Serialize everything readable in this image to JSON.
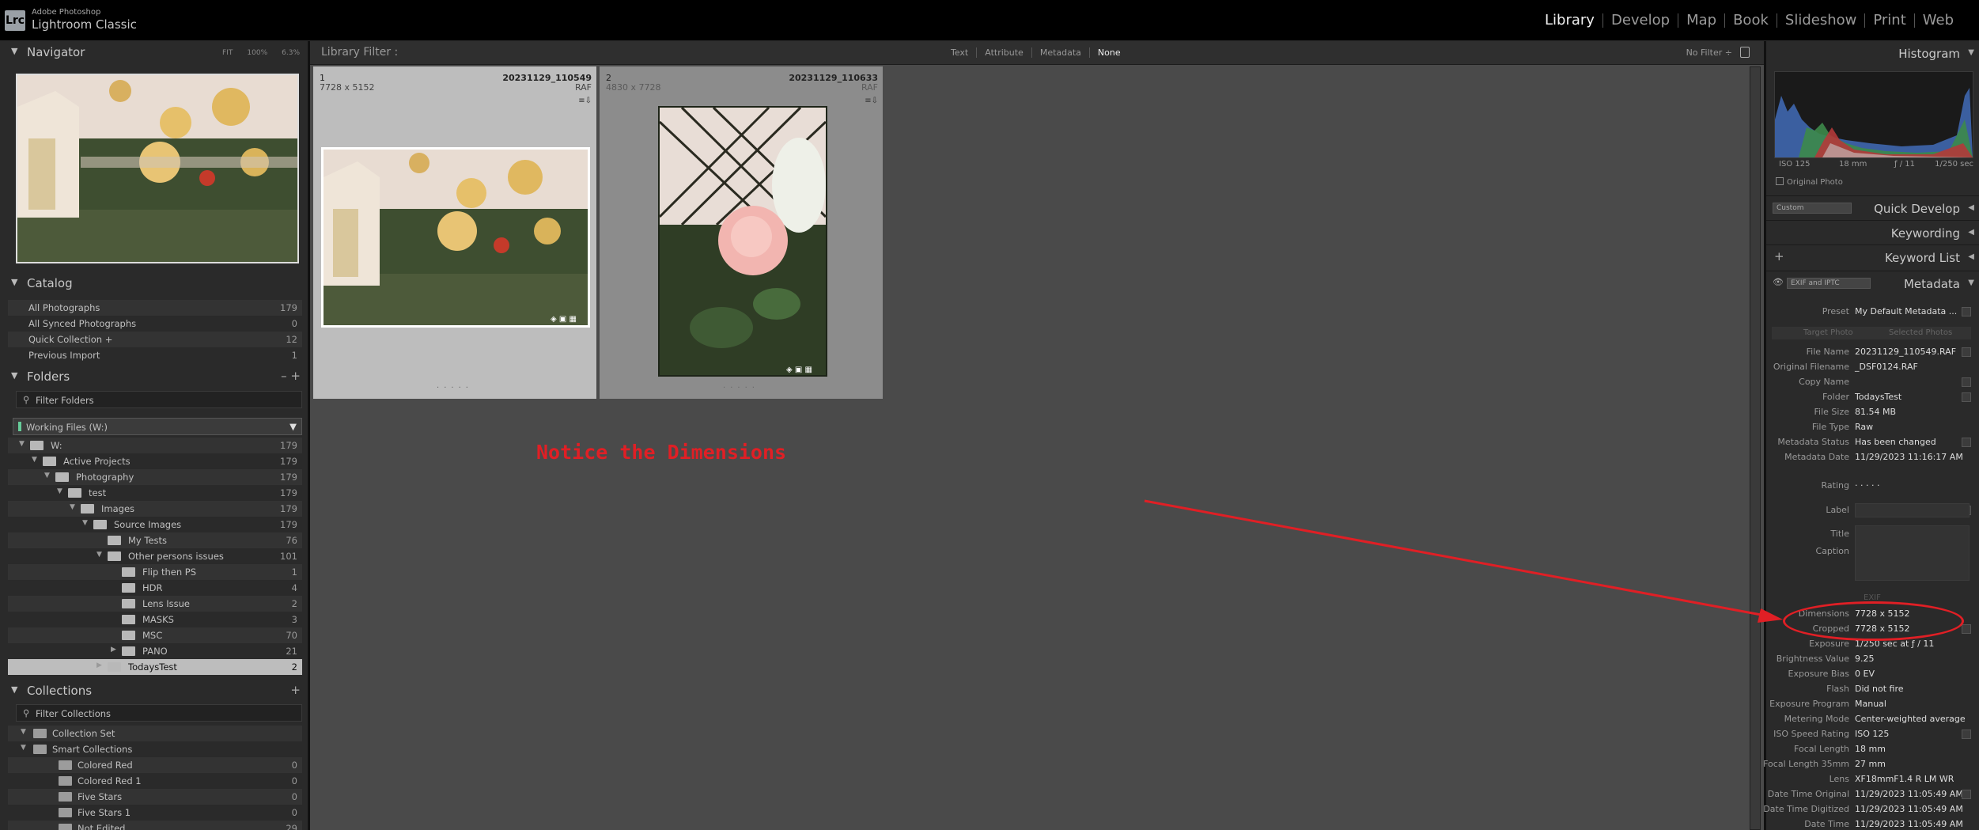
{
  "app": {
    "brand_line1": "Adobe Photoshop",
    "brand_line2": "Lightroom Classic",
    "logo": "Lrc"
  },
  "modules": [
    "Library",
    "Develop",
    "Map",
    "Book",
    "Slideshow",
    "Print",
    "Web"
  ],
  "navigator": {
    "title": "Navigator",
    "zoom": [
      "FIT",
      "100%",
      "6.3%"
    ]
  },
  "catalog": {
    "title": "Catalog",
    "items": [
      {
        "label": "All Photographs",
        "count": "179"
      },
      {
        "label": "All Synced Photographs",
        "count": "0"
      },
      {
        "label": "Quick Collection +",
        "count": "12"
      },
      {
        "label": "Previous Import",
        "count": "1"
      }
    ]
  },
  "folders": {
    "title": "Folders",
    "controls": "– +",
    "filter_placeholder": "Filter Folders",
    "volume": "Working Files (W:)",
    "items": [
      {
        "label": "W:",
        "count": "179"
      },
      {
        "label": "Active Projects",
        "count": "179"
      },
      {
        "label": "Photography",
        "count": "179"
      },
      {
        "label": "test",
        "count": "179"
      },
      {
        "label": "Images",
        "count": "179"
      },
      {
        "label": "Source Images",
        "count": "179"
      },
      {
        "label": "My Tests",
        "count": "76"
      },
      {
        "label": "Other persons issues",
        "count": "101"
      },
      {
        "label": "Flip then PS",
        "count": "1"
      },
      {
        "label": "HDR",
        "count": "4"
      },
      {
        "label": "Lens Issue",
        "count": "2"
      },
      {
        "label": "MASKS",
        "count": "3"
      },
      {
        "label": "MSC",
        "count": "70"
      },
      {
        "label": "PANO",
        "count": "21"
      },
      {
        "label": "TodaysTest",
        "count": "2"
      }
    ]
  },
  "collections": {
    "title": "Collections",
    "filter_placeholder": "Filter Collections",
    "items": [
      {
        "label": "Collection Set",
        "count": ""
      },
      {
        "label": "Smart Collections",
        "count": ""
      },
      {
        "label": "Colored Red",
        "count": "0"
      },
      {
        "label": "Colored Red 1",
        "count": "0"
      },
      {
        "label": "Five Stars",
        "count": "0"
      },
      {
        "label": "Five Stars 1",
        "count": "0"
      },
      {
        "label": "Not Edited",
        "count": "29"
      }
    ]
  },
  "library_filter": {
    "title": "Library Filter :",
    "modes": [
      "Text",
      "Attribute",
      "Metadata",
      "None"
    ],
    "preset": "No Filter ÷"
  },
  "grid": [
    {
      "index": "1",
      "filename": "20231129_110549",
      "dims": "7728 x 5152",
      "ext": "RAF"
    },
    {
      "index": "2",
      "filename": "20231129_110633",
      "dims": "4830 x 7728",
      "ext": "RAF"
    }
  ],
  "annotation": {
    "text": "Notice the Dimensions",
    "color": "#e01f25"
  },
  "histogram": {
    "title": "Histogram",
    "iso": "ISO 125",
    "focal": "18 mm",
    "aperture": "ƒ / 11",
    "shutter": "1/250 sec",
    "original_photo": "Original Photo"
  },
  "quick_develop": {
    "title": "Quick Develop",
    "preset": "Custom"
  },
  "keywording": {
    "title": "Keywording"
  },
  "keyword_list": {
    "title": "Keyword List"
  },
  "metadata": {
    "title": "Metadata",
    "view": "EXIF and IPTC",
    "preset_label": "Preset",
    "preset_value": "My Default Metadata ...",
    "target_photo": "Target Photo",
    "selected_photos": "Selected Photos",
    "exif_label": "EXIF",
    "rows": [
      {
        "k": "File Name",
        "v": "20231129_110549.RAF"
      },
      {
        "k": "Original Filename",
        "v": "_DSF0124.RAF"
      },
      {
        "k": "Copy Name",
        "v": ""
      },
      {
        "k": "Folder",
        "v": "TodaysTest"
      },
      {
        "k": "File Size",
        "v": "81.54 MB"
      },
      {
        "k": "File Type",
        "v": "Raw"
      },
      {
        "k": "Metadata Status",
        "v": "Has been changed"
      },
      {
        "k": "Metadata Date",
        "v": "11/29/2023 11:16:17 AM"
      }
    ],
    "rating_label": "Rating",
    "rating_value": "· · · · ·",
    "label_label": "Label",
    "title_label": "Title",
    "caption_label": "Caption",
    "exif_rows": [
      {
        "k": "Dimensions",
        "v": "7728 x 5152"
      },
      {
        "k": "Cropped",
        "v": "7728 x 5152"
      },
      {
        "k": "Exposure",
        "v": "1/250 sec at ƒ / 11"
      },
      {
        "k": "Brightness Value",
        "v": "9.25"
      },
      {
        "k": "Exposure Bias",
        "v": "0 EV"
      },
      {
        "k": "Flash",
        "v": "Did not fire"
      },
      {
        "k": "Exposure Program",
        "v": "Manual"
      },
      {
        "k": "Metering Mode",
        "v": "Center-weighted average"
      },
      {
        "k": "ISO Speed Rating",
        "v": "ISO 125"
      },
      {
        "k": "Focal Length",
        "v": "18 mm"
      },
      {
        "k": "Focal Length 35mm",
        "v": "27 mm"
      },
      {
        "k": "Lens",
        "v": "XF18mmF1.4 R LM WR"
      },
      {
        "k": "Date Time Original",
        "v": "11/29/2023 11:05:49 AM"
      },
      {
        "k": "Date Time Digitized",
        "v": "11/29/2023 11:05:49 AM"
      },
      {
        "k": "Date Time",
        "v": "11/29/2023 11:05:49 AM"
      }
    ]
  }
}
